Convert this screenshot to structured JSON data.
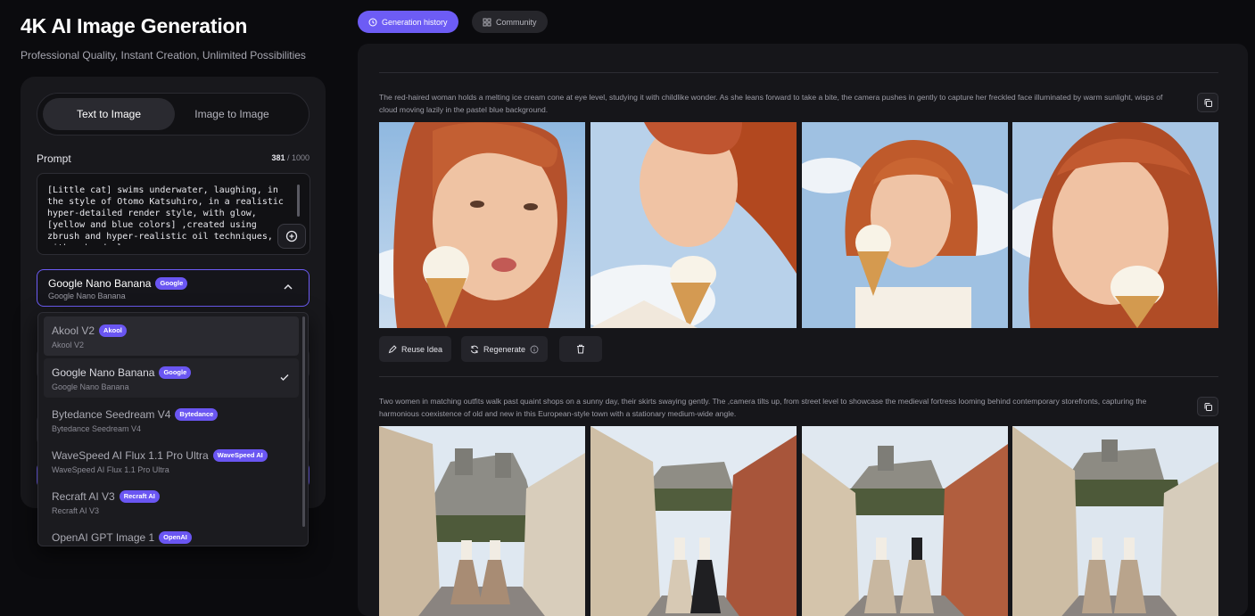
{
  "header": {
    "title": "4K AI Image Generation",
    "subtitle": "Professional Quality, Instant Creation, Unlimited Possibilities"
  },
  "mode_toggle": {
    "text_to_image": "Text to Image",
    "image_to_image": "Image to Image"
  },
  "prompt": {
    "label": "Prompt",
    "count_current": "381",
    "count_max": " / 1000",
    "text": "[Little cat] swims underwater, laughing, in the style of Otomo Katsuhiro, in a realistic hyper-detailed render style, with glow,[yellow and blue colors] ,created using zbrush and hyper-realistic oil techniques, with a head close-up"
  },
  "model_select": {
    "name": "Google Nano Banana",
    "badge": "Google",
    "sub": "Google Nano Banana"
  },
  "model_dropdown": [
    {
      "name": "Akool V2",
      "badge": "Akool",
      "sub": "Akool V2"
    },
    {
      "name": "Google Nano Banana",
      "badge": "Google",
      "sub": "Google Nano Banana"
    },
    {
      "name": "Bytedance Seedream V4",
      "badge": "Bytedance",
      "sub": "Bytedance Seedream V4"
    },
    {
      "name": "WaveSpeed AI Flux 1.1 Pro Ultra",
      "badge": "WaveSpeed AI",
      "sub": "WaveSpeed AI Flux 1.1 Pro Ultra"
    },
    {
      "name": "Recraft AI V3",
      "badge": "Recraft AI",
      "sub": "Recraft AI V3"
    },
    {
      "name": "OpenAI GPT Image 1",
      "badge": "OpenAI",
      "sub": ""
    }
  ],
  "tabs": {
    "history": "Generation history",
    "community": "Community"
  },
  "generations": [
    {
      "prompt": "The red-haired woman holds a melting ice cream cone at eye level, studying it with childlike wonder. As she leans forward to take a bite, the camera pushes in gently to capture her freckled face illuminated by warm sunlight, wisps of cloud moving lazily in the pastel blue background."
    },
    {
      "prompt": "Two women in matching outfits walk past quaint shops on a sunny day, their skirts swaying gently. The ,camera tilts up, from street level to showcase the medieval fortress looming behind contemporary storefronts, capturing the harmonious coexistence of old and new in this European-style town with a stationary medium-wide angle."
    }
  ],
  "actions": {
    "reuse": "Reuse Idea",
    "regenerate": "Regenerate"
  },
  "colors": {
    "accent": "#6d5cf5",
    "badge": "#6a56f2",
    "panel": "#18181c",
    "background": "#0b0b0e"
  }
}
